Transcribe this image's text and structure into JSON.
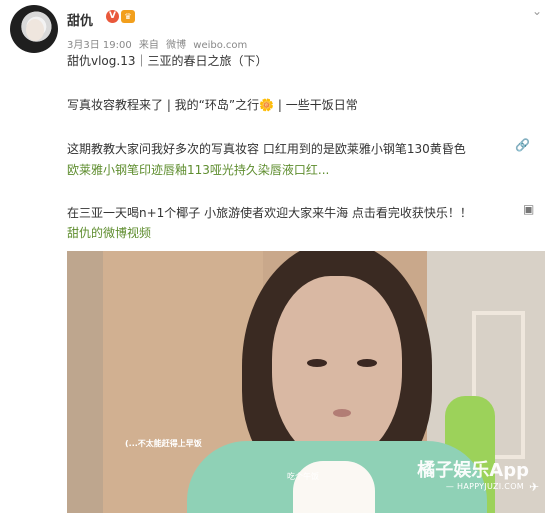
{
  "post": {
    "author": "甜仇",
    "verified_badge": "V",
    "crown_badge": "♛",
    "date": "3月3日 19:00",
    "source_prefix": "来自",
    "source_name": "微博",
    "source_domain": "weibo.com",
    "title_line": "甜仇vlog.13｜三亚的春日之旅（下）",
    "intro_line": "写真妆容教程来了 | 我的“环岛”之行🌼 | 一些干饭日常",
    "description_line": "这期教教大家问我好多次的写真妆容 口红用到的是欧莱雅小钢笔130黄昏色",
    "product_link": "欧莱雅小钢笔印迹唇釉113哑光持久染唇液口红...",
    "travel_line": "在三亚一天喝n+1个椰子 小旅游使者欢迎大家来牛海 点击看完收获快乐！！",
    "video_link": "甜仇的微博视频"
  },
  "video": {
    "subtitle": "(...不太能赶得上早饭",
    "small_caption": "吃个午饭",
    "watermark_main": "橘子娱乐App",
    "watermark_sub": "— HAPPYJUZI.COM"
  },
  "icons": {
    "menu_arrow": "chevron-down-icon",
    "link_icon": "link-icon",
    "video_icon": "video-icon",
    "watermark_play": "play-icon"
  }
}
